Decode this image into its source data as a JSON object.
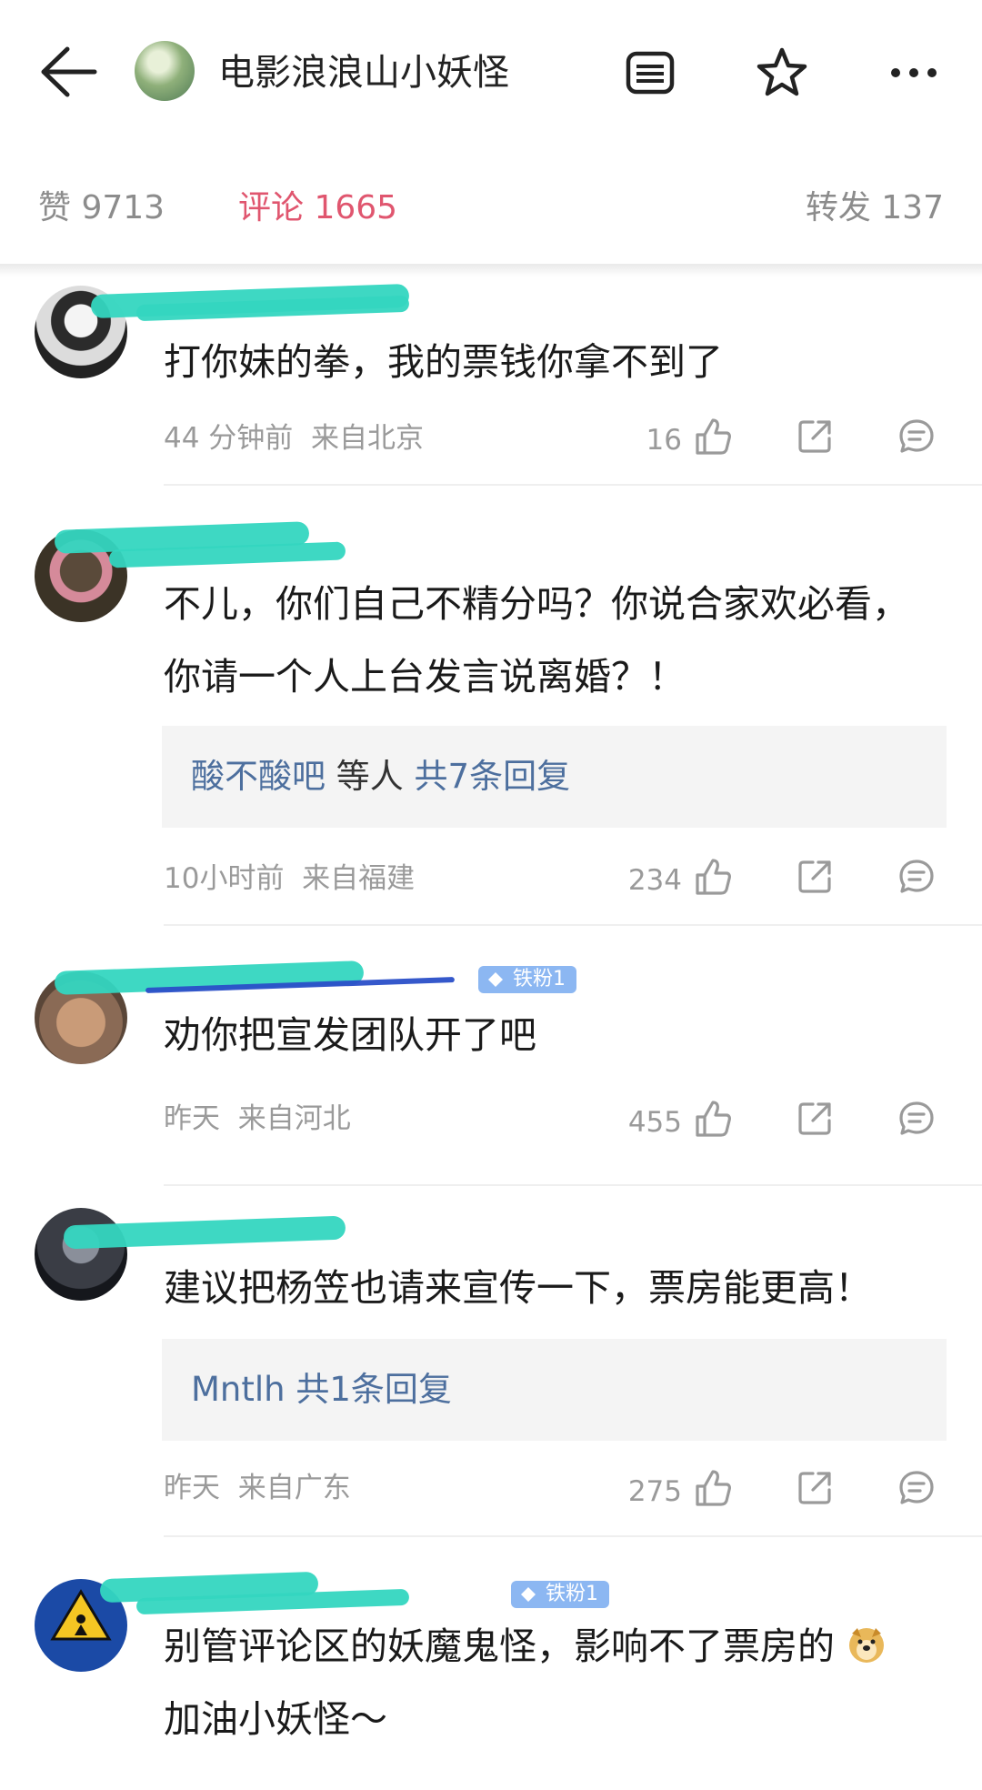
{
  "header": {
    "title": "电影浪浪山小妖怪",
    "back_icon": "arrow-left-icon",
    "icons": [
      "list-icon",
      "star-icon",
      "more-icon"
    ]
  },
  "tabs": [
    {
      "label": "赞 9713"
    },
    {
      "label": "评论 1665",
      "active": true
    },
    {
      "label": "转发 137"
    }
  ],
  "colors": {
    "accent": "#e0566f",
    "link": "#4d6f9e",
    "badge": "#8cb7f2",
    "redaction": "#34d6c0"
  },
  "comments": [
    {
      "text": "打你妹的拳，我的票钱你拿不到了",
      "time": "44 分钟前",
      "location": "来自北京",
      "likes": "16"
    },
    {
      "text_lines": [
        "不儿，你们自己不精分吗？你说合家欢必看，",
        "你请一个人上台发言说离婚？！"
      ],
      "reply": {
        "author": "酸不酸吧",
        "middle": " 等人 ",
        "count": "共7条回复"
      },
      "time": "10小时前",
      "location": "来自福建",
      "likes": "234"
    },
    {
      "text": "劝你把宣发团队开了吧",
      "badge": "铁粉1",
      "time": "昨天",
      "location": "来自河北",
      "likes": "455"
    },
    {
      "text": "建议把杨笠也请来宣传一下，票房能更高！",
      "reply": {
        "author": "Mntlh",
        "count": "共1条回复"
      },
      "time": "昨天",
      "location": "来自广东",
      "likes": "275"
    },
    {
      "text_lines": [
        "别管评论区的妖魔鬼怪，影响不了票房的",
        "加油小妖怪～"
      ],
      "badge": "铁粉1"
    }
  ]
}
